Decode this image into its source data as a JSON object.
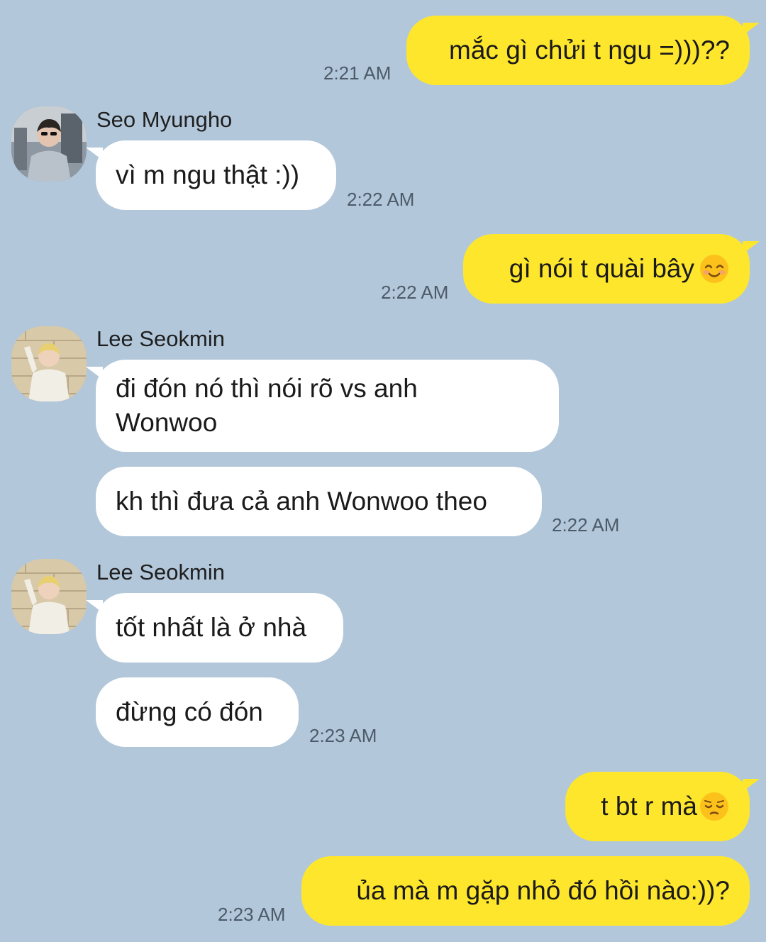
{
  "messages": {
    "m1": {
      "text": "mắc gì chửi t ngu =)))??",
      "time": "2:21 AM"
    },
    "m2": {
      "sender": "Seo Myungho",
      "text": "vì m ngu thật :))",
      "time": "2:22 AM"
    },
    "m3": {
      "text": "gì nói t quài bây",
      "time": "2:22 AM"
    },
    "m4": {
      "sender": "Lee Seokmin",
      "text": "đi đón nó thì nói rõ vs anh Wonwoo"
    },
    "m5": {
      "text": "kh thì đưa cả anh Wonwoo theo",
      "time": "2:22 AM"
    },
    "m6": {
      "sender": "Lee Seokmin",
      "text": "tốt nhất là ở nhà"
    },
    "m7": {
      "text": "đừng có đón",
      "time": "2:23 AM"
    },
    "m8": {
      "text": "t bt r mà"
    },
    "m9": {
      "text": "ủa mà m gặp nhỏ đó hồi nào:))?",
      "time": "2:23 AM"
    }
  },
  "icons": {
    "smile_emoji": "smiling-face-with-smiling-eyes-icon",
    "pensive_emoji": "pensive-face-icon"
  },
  "colors": {
    "background": "#b2c7da",
    "my_bubble": "#fee62c",
    "other_bubble": "#ffffff"
  }
}
